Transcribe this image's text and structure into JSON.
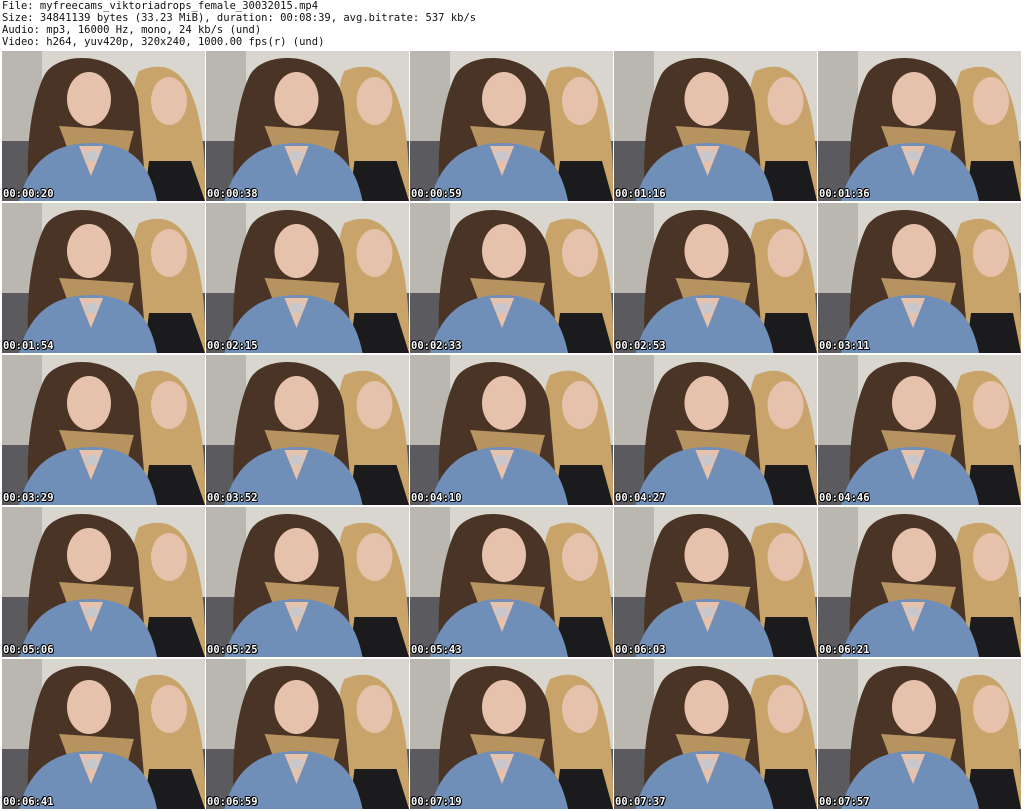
{
  "header": {
    "file_line": "File: myfreecams_viktoriadrops_female_30032015.mp4",
    "size_line": "Size: 34841139 bytes (33.23 MiB), duration: 00:08:39, avg.bitrate: 537 kb/s",
    "audio_line": "Audio: mp3, 16000 Hz, mono, 24 kb/s (und)",
    "video_line": "Video: h264, yuv420p, 320x240, 1000.00 fps(r) (und)"
  },
  "thumbnails": [
    {
      "timestamp": "00:00:20"
    },
    {
      "timestamp": "00:00:38"
    },
    {
      "timestamp": "00:00:59"
    },
    {
      "timestamp": "00:01:16"
    },
    {
      "timestamp": "00:01:36"
    },
    {
      "timestamp": "00:01:54"
    },
    {
      "timestamp": "00:02:15"
    },
    {
      "timestamp": "00:02:33"
    },
    {
      "timestamp": "00:02:53"
    },
    {
      "timestamp": "00:03:11"
    },
    {
      "timestamp": "00:03:29"
    },
    {
      "timestamp": "00:03:52"
    },
    {
      "timestamp": "00:04:10"
    },
    {
      "timestamp": "00:04:27"
    },
    {
      "timestamp": "00:04:46"
    },
    {
      "timestamp": "00:05:06"
    },
    {
      "timestamp": "00:05:25"
    },
    {
      "timestamp": "00:05:43"
    },
    {
      "timestamp": "00:06:03"
    },
    {
      "timestamp": "00:06:21"
    },
    {
      "timestamp": "00:06:41"
    },
    {
      "timestamp": "00:06:59"
    },
    {
      "timestamp": "00:07:19"
    },
    {
      "timestamp": "00:07:37"
    },
    {
      "timestamp": "00:07:57"
    }
  ],
  "colors": {
    "background": "#ffffff",
    "wall": "#d8d6cf",
    "denim": "#6f8fb8",
    "dark_hair": "#4a3426",
    "blonde_hair": "#c9a46a",
    "skin": "#e6c2ad",
    "timestamp_text": "#ffffff"
  }
}
